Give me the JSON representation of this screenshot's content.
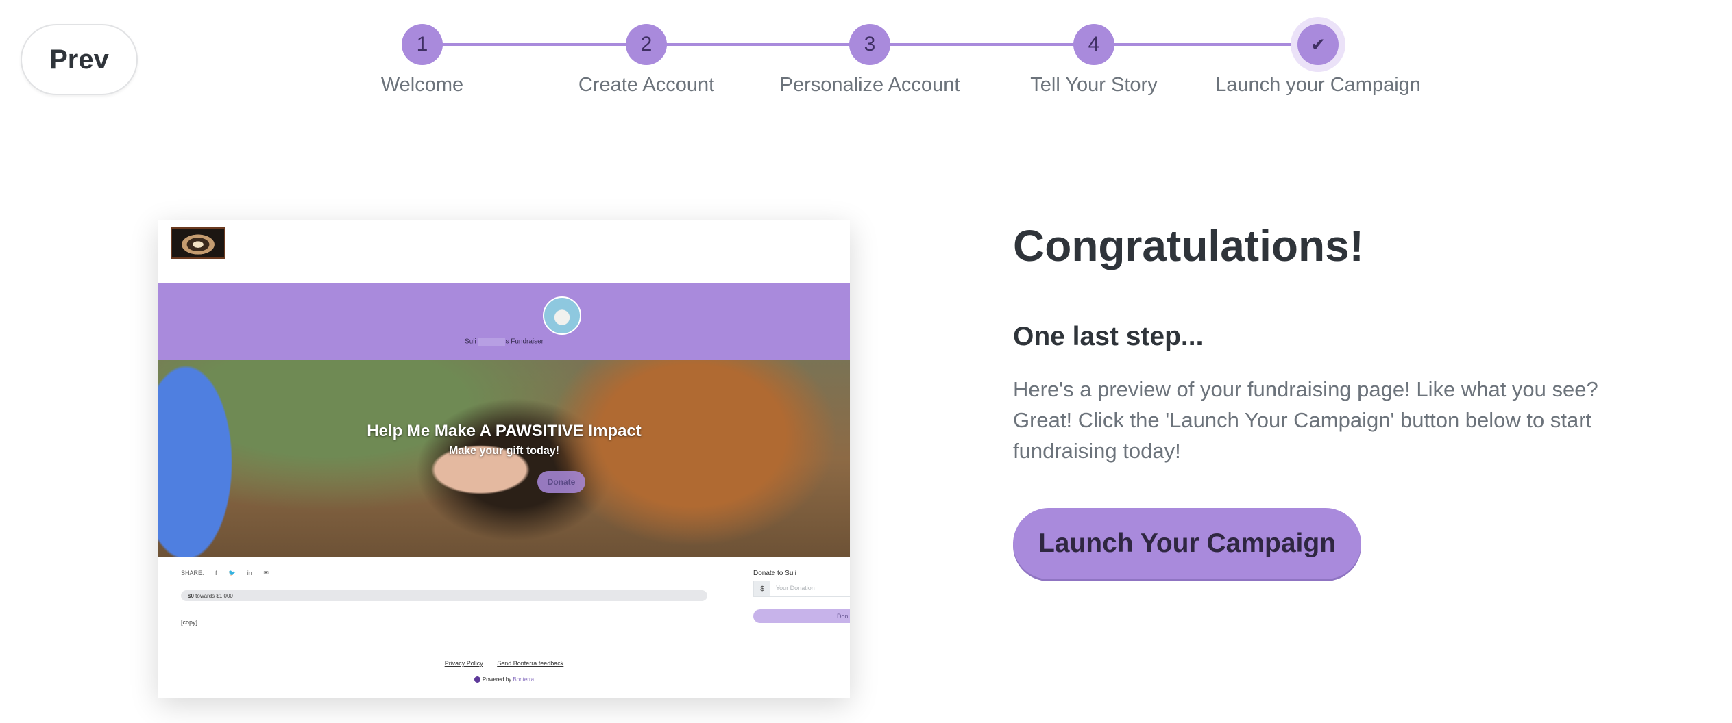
{
  "nav": {
    "prev_label": "Prev"
  },
  "stepper": {
    "steps": [
      {
        "number": "1",
        "label": "Welcome"
      },
      {
        "number": "2",
        "label": "Create Account"
      },
      {
        "number": "3",
        "label": "Personalize Account"
      },
      {
        "number": "4",
        "label": "Tell Your Story"
      },
      {
        "number": "✔",
        "label": "Launch your Campaign"
      }
    ],
    "current_step": 5,
    "accent_color": "#a98adc"
  },
  "preview": {
    "banner_name_prefix": "Suli",
    "banner_name_suffix": "s Fundraiser",
    "hero_title": "Help Me Make A PAWSITIVE Impact",
    "hero_subtitle": "Make your gift today!",
    "hero_donate_label": "Donate",
    "share_label": "SHARE:",
    "share_icons": [
      "f",
      "🐦",
      "in",
      "✉"
    ],
    "progress_amount": "$0",
    "progress_text": "towards $1,000",
    "copy_text": "[copy]",
    "donate_to_label": "Donate to Suli",
    "currency_symbol": "$",
    "donation_placeholder": "Your Donation",
    "donate_button_label": "Don",
    "footer_privacy": "Privacy Policy",
    "footer_feedback": "Send Bonterra feedback",
    "powered_by": "Powered by",
    "powered_brand": "Bonterra"
  },
  "content": {
    "title": "Congratulations!",
    "subtitle": "One last step...",
    "description": "Here's a preview of your fundraising page! Like what you see? Great! Click the 'Launch Your Campaign' button below to start fundraising today!",
    "launch_button": "Launch Your Campaign"
  }
}
